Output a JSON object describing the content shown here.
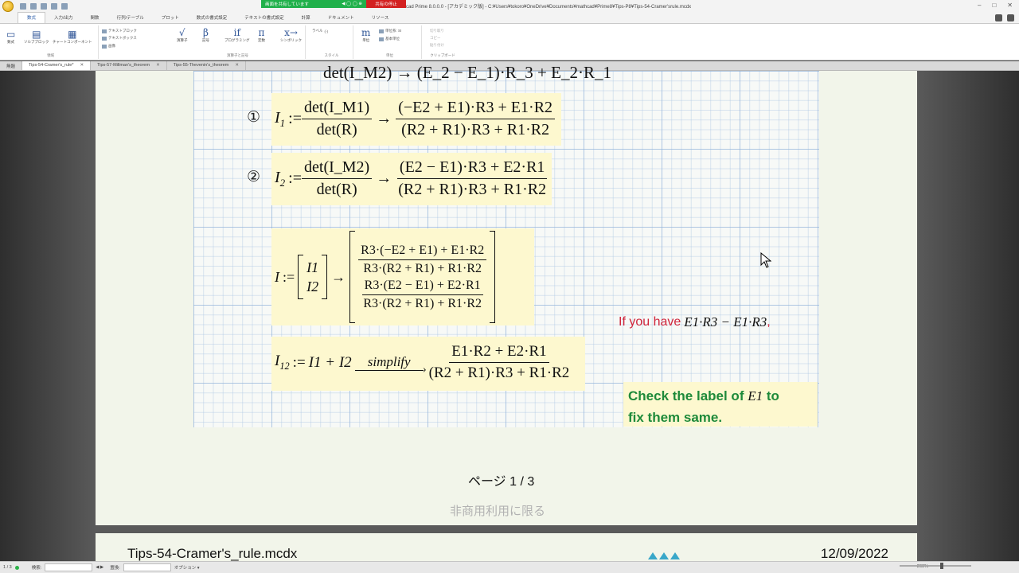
{
  "titlebar": {
    "share_status": "画面を共有しています",
    "stop_share": "共有の停止",
    "window_title": "cad Prime 8.0.0.0 - [アカデミック版] - C:¥Users¥tokoro¥OneDrive¥Documents¥mathcad¥Prime8¥Tips-P8¥Tips-54-Cramer'srule.mcdx"
  },
  "ribbon_tabs": [
    "数式",
    "入力/出力",
    "関数",
    "行列/テーブル",
    "プロット",
    "数式の書式設定",
    "テキストの書式設定",
    "計算",
    "ドキュメント",
    "リソース"
  ],
  "ribbon": {
    "math": "数式",
    "solve_block": "ソルブブロック",
    "chart_component": "チャートコンポーネント",
    "text_block": "テキストブロック",
    "text_box": "テキストボックス",
    "image": "画像",
    "group_regions": "領域",
    "operators": "演算子",
    "symbols": "記号",
    "programming": "プログラミング",
    "constants": "定数",
    "symbolics": "シンボリック",
    "group_math": "演算子と記号",
    "label": "ラベル",
    "label_value": "(-)",
    "group_style": "スタイル",
    "units": "単位",
    "unit_system": "単位系: SI",
    "base_units": "基本単位",
    "group_units": "単位",
    "cut": "切り取り",
    "copy": "コピー",
    "paste": "貼り付け",
    "group_clipboard": "クリップボード",
    "glyph_operators": "√",
    "glyph_symbols": "β",
    "glyph_programming": "if",
    "glyph_constants": "π",
    "glyph_symbolics": "x→",
    "glyph_units": "m"
  },
  "doc_tabs": [
    {
      "label": "無題",
      "active": false
    },
    {
      "label": "Tips-54-Cramer's_rule*",
      "active": true
    },
    {
      "label": "Tips-57-Millman's_theorem",
      "active": false
    },
    {
      "label": "Tips-55-Thevenin's_theorem",
      "active": false
    }
  ],
  "worksheet": {
    "top_partial": "det(I_M2) → (E_2 − E_1)·R_3 + E_2·R_1",
    "eq1": {
      "marker": "①",
      "lhs": "I",
      "lhs_sub": "1",
      "def_num": "det(I_M1)",
      "def_den": "det(R)",
      "res_num": "(−E2 + E1)·R3 + E1·R2",
      "res_den": "(R2 + R1)·R3 + R1·R2"
    },
    "eq2": {
      "marker": "②",
      "lhs": "I",
      "lhs_sub": "2",
      "def_num": "det(I_M2)",
      "def_den": "det(R)",
      "res_num": "(E2 − E1)·R3 + E2·R1",
      "res_den": "(R2 + R1)·R3 + R1·R2"
    },
    "matrix_eq": {
      "lhs": "I",
      "entries": [
        "I1",
        "I2"
      ],
      "row1_num": "R3·(−E2 + E1) + E1·R2",
      "row1_den": "R3·(R2 + R1) + R1·R2",
      "row2_num": "R3·(E2 − E1) + E2·R1",
      "row2_den": "R3·(R2 + R1) + R1·R2"
    },
    "sum_eq": {
      "lhs": "I",
      "lhs_sub": "12",
      "expr": "I1 + I2",
      "keyword": "simplify",
      "res_num": "E1·R2 + E2·R1",
      "res_den": "(R2 + R1)·R3 + R1·R2"
    },
    "note_red_text": "If you have",
    "note_red_math": "E1·R3 − E1·R3",
    "note_green_line1": "Check the label of",
    "note_green_math": "E1",
    "note_green_line1_end": "to",
    "note_green_line2": "fix them same.",
    "page_indicator": "ページ 1 / 3",
    "noncommercial": "非商用利用に限る"
  },
  "footer": {
    "filename": "Tips-54-Cramer's_rule.mcdx",
    "date": "12/09/2022"
  },
  "statusbar": {
    "page": "1 / 3",
    "search_label": "検索:",
    "replace_label": "置換:",
    "options": "オプション",
    "zoom": "260%"
  },
  "colors": {
    "region_bg": "#fdf8cf",
    "note_red": "#d0243a",
    "note_green": "#1e8a3a",
    "share_green": "#21b04b",
    "share_red": "#d32121"
  }
}
